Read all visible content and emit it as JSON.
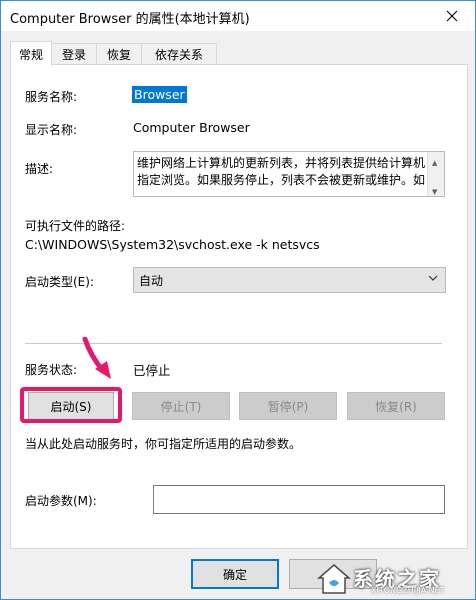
{
  "window": {
    "title": "Computer Browser 的属性(本地计算机)"
  },
  "tabs": [
    {
      "label": "常规",
      "active": true
    },
    {
      "label": "登录",
      "active": false
    },
    {
      "label": "恢复",
      "active": false
    },
    {
      "label": "依存关系",
      "active": false
    }
  ],
  "general": {
    "service_name_label": "服务名称:",
    "service_name_value": "Browser",
    "display_name_label": "显示名称:",
    "display_name_value": "Computer Browser",
    "description_label": "描述:",
    "description_line1": "维护网络上计算机的更新列表，并将列表提供给计算机",
    "description_line2": "指定浏览。如果服务停止，列表不会被更新或维护。如",
    "path_label": "可执行文件的路径:",
    "path_value": "C:\\WINDOWS\\System32\\svchost.exe -k netsvcs",
    "startup_type_label": "启动类型(E):",
    "startup_type_value": "自动",
    "status_label": "服务状态:",
    "status_value": "已停止",
    "buttons": {
      "start": "启动(S)",
      "stop": "停止(T)",
      "pause": "暂停(P)",
      "resume": "恢复(R)"
    },
    "hint": "当从此处启动服务时，你可指定所适用的启动参数。",
    "params_label": "启动参数(M):",
    "params_value": ""
  },
  "footer": {
    "ok": "确定"
  },
  "annotation": {
    "color": "#e6176f"
  },
  "watermark": {
    "text": "系统之家",
    "url": "XITONGZHIJIA.NET"
  }
}
